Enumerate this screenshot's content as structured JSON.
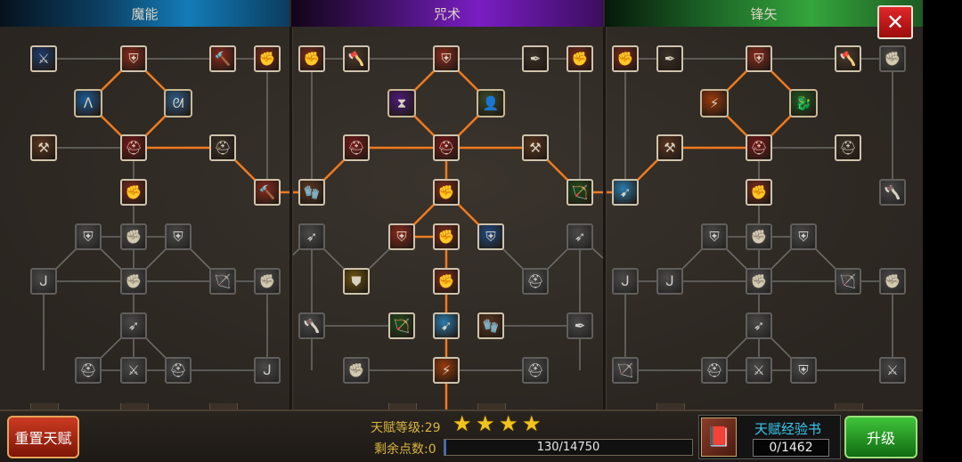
{
  "trees": [
    {
      "name": "魔能",
      "color": "#137cb8"
    },
    {
      "name": "咒术",
      "color": "#7a1dc4"
    },
    {
      "name": "锋矢",
      "color": "#34a53c"
    }
  ],
  "close_symbol": "✕",
  "footer": {
    "reset_label": "重置天赋",
    "level_label": "天赋等级:29",
    "points_label": "剩余点数:0",
    "stars": 4,
    "progress_text": "130/14750",
    "progress_value": 130,
    "progress_max": 14750,
    "book_title": "天赋经验书",
    "book_count": "0/1462",
    "upgrade_label": "升级"
  },
  "colors": {
    "path_active": "#f07a1e",
    "path_inactive": "#6b6a66",
    "star": "#f1c31e"
  },
  "icons": {
    "rough-staff": "rough-staff-icon",
    "blue-sword": "blue-sword-icon",
    "silver-shield": "silver-shield-icon",
    "red-hammer": "red-hammer-icon",
    "red-fist": "red-fist-icon",
    "stone-axe": "stone-axe-icon",
    "feather-quill": "feather-quill-icon",
    "blue-rune": "blue-rune-icon",
    "blue-claw": "blue-claw-icon",
    "wooden-club": "wooden-club-icon",
    "red-helm": "red-helm-icon",
    "leather-glove": "leather-glove-icon",
    "bronze-shield": "bronze-shield-icon",
    "iron-fist": "iron-fist-icon",
    "dark-hook": "dark-hook-icon",
    "archer": "archer-icon",
    "crossed-blades": "crossed-blades-icon",
    "bow-wind": "bow-wind-icon",
    "purple-hourglass": "purple-hourglass-icon",
    "hooded-figure": "hooded-figure-icon",
    "blue-crest-shield": "blue-crest-shield-icon",
    "gold-armor": "gold-armor-icon",
    "green-archer": "green-archer-icon",
    "cyan-blade": "cyan-blade-icon",
    "flame-strike": "flame-strike-icon",
    "green-dragon": "green-dragon-icon"
  }
}
